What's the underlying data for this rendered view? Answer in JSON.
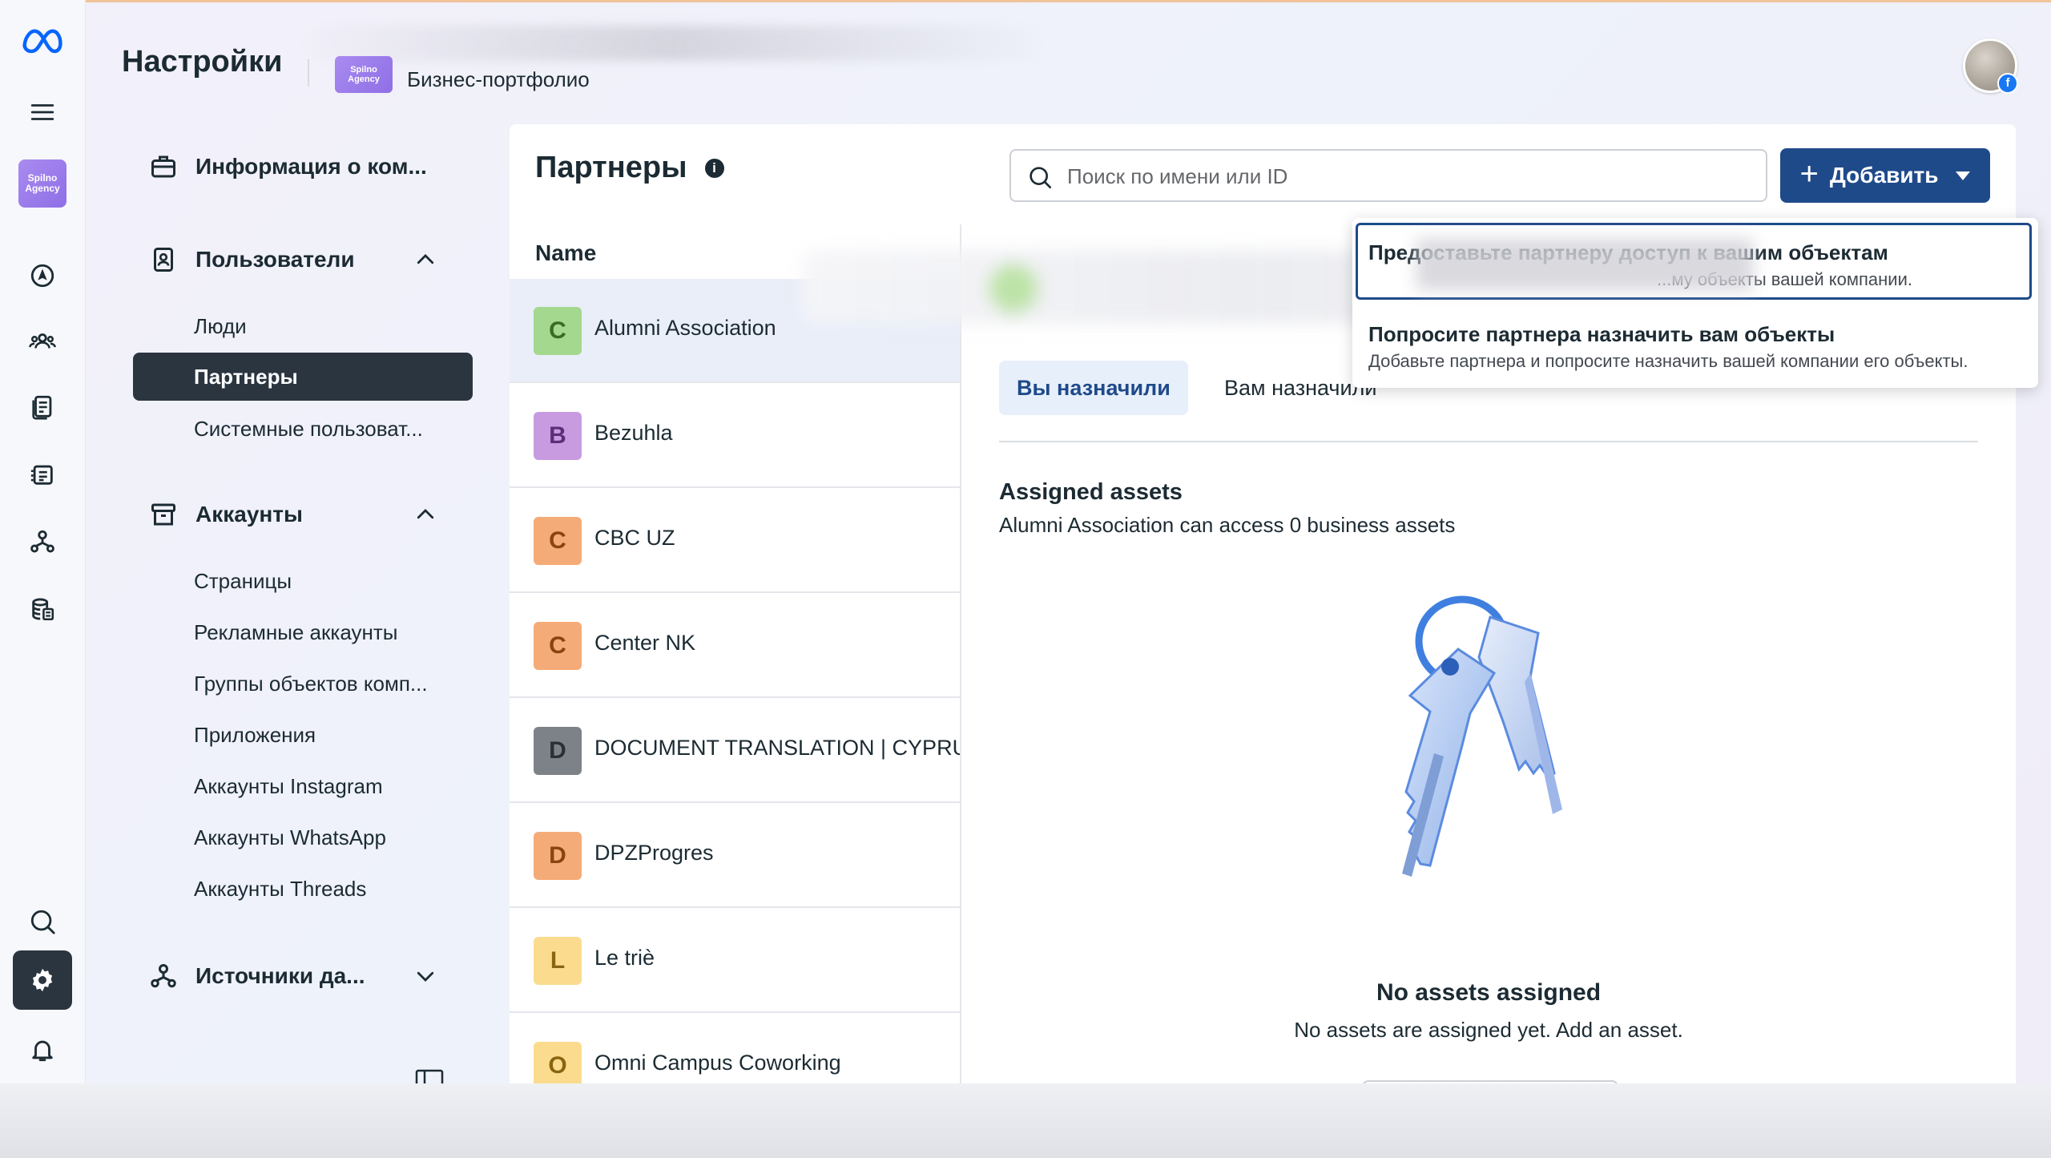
{
  "header": {
    "title": "Настройки",
    "business_logo_text": [
      "Spilno",
      "Agency"
    ],
    "portfolio": "Бизнес-портфолио"
  },
  "rail": {
    "items": [
      "meta-logo-icon",
      "menu-icon",
      "business-logo",
      "compass-icon",
      "people-icon",
      "document-icon",
      "calendar-icon",
      "network-icon",
      "database-icon",
      "search-icon",
      "gear-icon",
      "bell-icon"
    ],
    "active": "gear-icon"
  },
  "nav": {
    "company_info": "Информация о ком...",
    "users": {
      "label": "Пользователи",
      "items": [
        "Люди",
        "Партнеры",
        "Системные пользоват..."
      ],
      "active": "Партнеры"
    },
    "accounts": {
      "label": "Аккаунты",
      "items": [
        "Страницы",
        "Рекламные аккаунты",
        "Группы объектов комп...",
        "Приложения",
        "Аккаунты Instagram",
        "Аккаунты WhatsApp",
        "Аккаунты Threads"
      ]
    },
    "data_sources": "Источники да..."
  },
  "main": {
    "title": "Партнеры",
    "info_glyph": "i",
    "search_placeholder": "Поиск по имени или ID",
    "add_button": "Добавить",
    "add_plus": "+",
    "column_header": "Name",
    "partners": [
      {
        "letter": "C",
        "name": "Alumni Association",
        "color": "#a5d88f",
        "text": "#3a6b25",
        "selected": true
      },
      {
        "letter": "B",
        "name": "Bezuhla",
        "color": "#c89be0",
        "text": "#5a2f7a"
      },
      {
        "letter": "C",
        "name": "CBC UZ",
        "color": "#f5ab77",
        "text": "#8a4312"
      },
      {
        "letter": "C",
        "name": "Center NK",
        "color": "#f5ab77",
        "text": "#8a4312"
      },
      {
        "letter": "D",
        "name": "DOCUMENT TRANSLATION | CYPRUS",
        "color": "#7d8289",
        "text": "#2c3036"
      },
      {
        "letter": "D",
        "name": "DPZProgres",
        "color": "#f5ab77",
        "text": "#8a4312"
      },
      {
        "letter": "L",
        "name": "Le triè",
        "color": "#fbdc8e",
        "text": "#8a6410"
      },
      {
        "letter": "O",
        "name": "Omni Campus Coworking",
        "color": "#fbdc8e",
        "text": "#8a6410"
      }
    ],
    "tabs": [
      "Вы назначили",
      "Вам назначили"
    ],
    "active_tab": "Вы назначили",
    "assigned_title": "Assigned assets",
    "assigned_subtitle": "Alumni Association can access 0 business assets",
    "empty_title": "No assets assigned",
    "empty_subtitle": "No assets are assigned yet. Add an asset."
  },
  "dropdown": {
    "option1_title": "Предоставьте партнеру доступ к вашим объектам",
    "option1_desc": "...му объекты вашей компании.",
    "option2_title": "Попросите партнера назначить вам объекты",
    "option2_desc": "Добавьте партнера и попросите назначить вашей компании его объекты."
  },
  "colors": {
    "accent": "#1f4a8a",
    "active_nav": "#2b3540",
    "facebook": "#1877f2"
  }
}
